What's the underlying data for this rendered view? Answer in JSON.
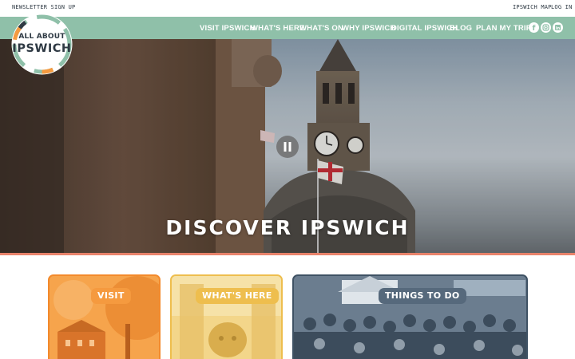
{
  "utility": {
    "newsletter": "NEWSLETTER SIGN UP",
    "map": "IPSWICH MAP",
    "login": "LOG IN"
  },
  "logo": {
    "line1": "ALL ABOUT",
    "line2": "IPSWICH"
  },
  "nav": {
    "items": [
      "VISIT IPSWICH",
      "WHAT'S HERE",
      "WHAT'S ON",
      "WHY IPSWICH",
      "DIGITAL IPSWICH",
      "BLOG",
      "PLAN MY TRIP"
    ],
    "social_icons": [
      "facebook-icon",
      "instagram-icon",
      "linkedin-icon"
    ]
  },
  "hero": {
    "title": "DISCOVER IPSWICH",
    "control_icon": "pause-icon"
  },
  "cards": [
    {
      "label": "VISIT",
      "color": "#f59a3f"
    },
    {
      "label": "WHAT'S HERE",
      "color": "#f2cf7a"
    },
    {
      "label": "THINGS TO DO",
      "color": "#56697c"
    }
  ],
  "colors": {
    "nav_bg": "#8fc0a9",
    "accent_border": "#e8836b",
    "text_dark": "#2f3a44"
  }
}
